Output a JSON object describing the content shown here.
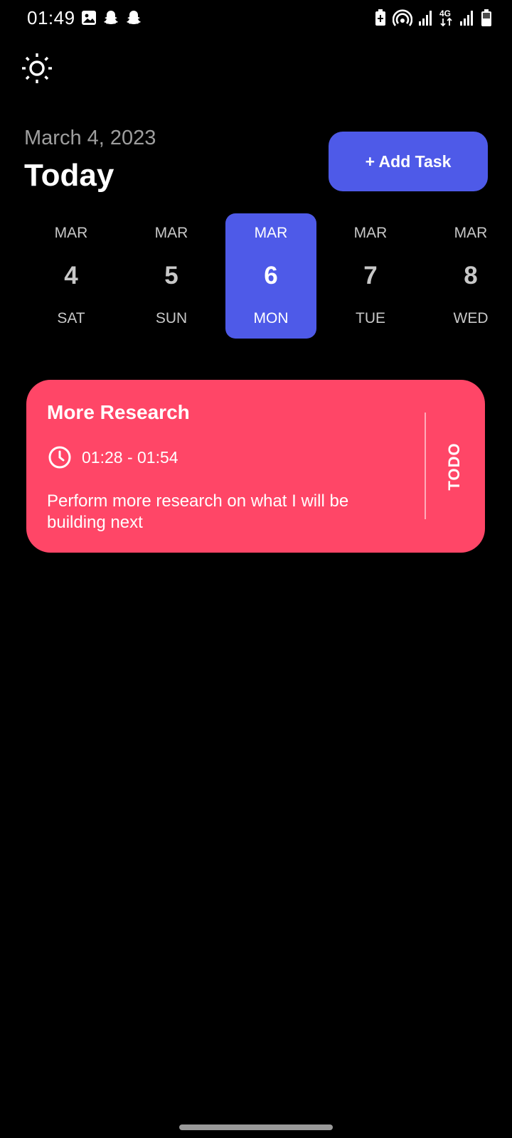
{
  "status_bar": {
    "time": "01:49",
    "left_icons": [
      "gallery-icon",
      "snapchat-icon",
      "snapchat-icon"
    ],
    "right_icons": [
      "battery-saver-icon",
      "hotspot-icon",
      "signal-icon",
      "4g-icon",
      "signal-icon",
      "battery-icon"
    ],
    "network_label": "4G"
  },
  "theme_toggle": {
    "icon": "sun-icon"
  },
  "header": {
    "date": "March 4, 2023",
    "title": "Today",
    "add_task_label": "+ Add Task"
  },
  "date_strip": {
    "selected_index": 2,
    "items": [
      {
        "month": "MAR",
        "day": "4",
        "weekday": "SAT"
      },
      {
        "month": "MAR",
        "day": "5",
        "weekday": "SUN"
      },
      {
        "month": "MAR",
        "day": "6",
        "weekday": "MON"
      },
      {
        "month": "MAR",
        "day": "7",
        "weekday": "TUE"
      },
      {
        "month": "MAR",
        "day": "8",
        "weekday": "WED"
      }
    ]
  },
  "tasks": [
    {
      "title": "More Research",
      "time": "01:28 - 01:54",
      "description": "Perform more research on what I will be building next",
      "status": "TODO",
      "color": "#ff4667"
    }
  ],
  "colors": {
    "accent": "#4e5ae8",
    "task_card": "#ff4667",
    "background": "#000000"
  }
}
